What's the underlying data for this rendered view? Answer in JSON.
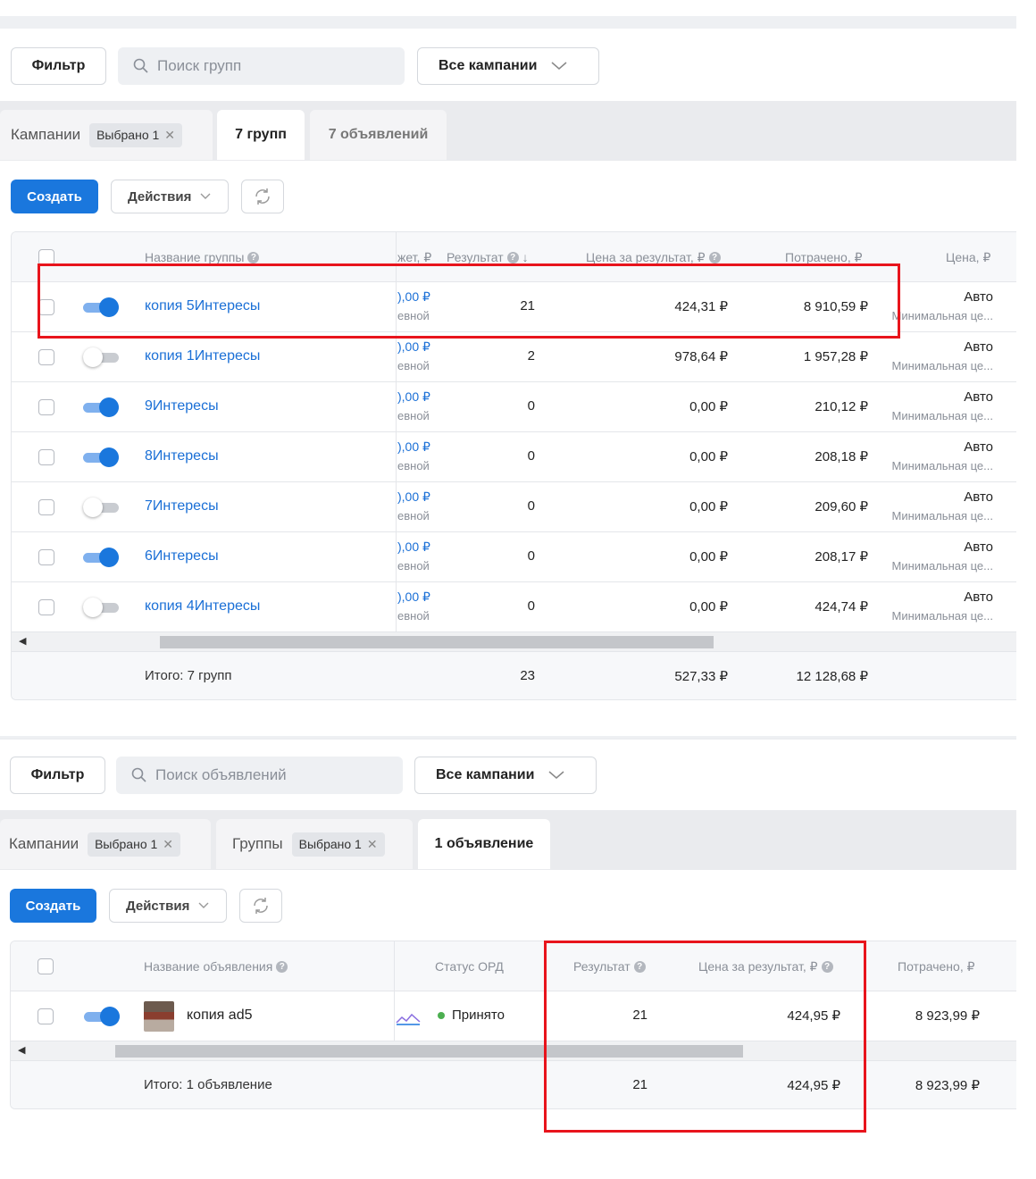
{
  "panel1": {
    "toolbar": {
      "filter_label": "Фильтр",
      "search_placeholder": "Поиск групп",
      "campaigns_select": "Все кампании"
    },
    "tabs": {
      "campaigns_label": "Кампании",
      "campaigns_chip": "Выбрано 1",
      "groups_tab": "7 групп",
      "ads_tab": "7 объявлений"
    },
    "actions": {
      "create": "Создать",
      "actions": "Действия"
    },
    "table": {
      "headers": {
        "name": "Название группы",
        "budget": "жет, ₽",
        "result": "Результат",
        "cost_per_result": "Цена за результат, ₽",
        "spent": "Потрачено, ₽",
        "price": "Цена, ₽"
      },
      "rows": [
        {
          "name": "копия 5Интересы",
          "toggle": "on",
          "budget": "),00 ₽",
          "budget_sub": "евной",
          "result": "21",
          "cpr": "424,31 ₽",
          "spent": "8 910,59 ₽",
          "price": "Авто",
          "price_sub": "Минимальная це..."
        },
        {
          "name": "копия 1Интересы",
          "toggle": "off",
          "budget": "),00 ₽",
          "budget_sub": "евной",
          "result": "2",
          "cpr": "978,64 ₽",
          "spent": "1 957,28 ₽",
          "price": "Авто",
          "price_sub": "Минимальная це..."
        },
        {
          "name": "9Интересы",
          "toggle": "on",
          "budget": "),00 ₽",
          "budget_sub": "евной",
          "result": "0",
          "cpr": "0,00 ₽",
          "spent": "210,12 ₽",
          "price": "Авто",
          "price_sub": "Минимальная це..."
        },
        {
          "name": "8Интересы",
          "toggle": "on",
          "budget": "),00 ₽",
          "budget_sub": "евной",
          "result": "0",
          "cpr": "0,00 ₽",
          "spent": "208,18 ₽",
          "price": "Авто",
          "price_sub": "Минимальная це..."
        },
        {
          "name": "7Интересы",
          "toggle": "off",
          "budget": "),00 ₽",
          "budget_sub": "евной",
          "result": "0",
          "cpr": "0,00 ₽",
          "spent": "209,60 ₽",
          "price": "Авто",
          "price_sub": "Минимальная це..."
        },
        {
          "name": "6Интересы",
          "toggle": "on",
          "budget": "),00 ₽",
          "budget_sub": "евной",
          "result": "0",
          "cpr": "0,00 ₽",
          "spent": "208,17 ₽",
          "price": "Авто",
          "price_sub": "Минимальная це..."
        },
        {
          "name": "копия 4Интересы",
          "toggle": "off",
          "budget": "),00 ₽",
          "budget_sub": "евной",
          "result": "0",
          "cpr": "0,00 ₽",
          "spent": "424,74 ₽",
          "price": "Авто",
          "price_sub": "Минимальная це..."
        }
      ],
      "totals": {
        "label": "Итого: 7 групп",
        "result": "23",
        "cpr": "527,33 ₽",
        "spent": "12 128,68 ₽"
      }
    }
  },
  "panel2": {
    "toolbar": {
      "filter_label": "Фильтр",
      "search_placeholder": "Поиск объявлений",
      "campaigns_select": "Все кампании"
    },
    "tabs": {
      "campaigns_label": "Кампании",
      "campaigns_chip": "Выбрано 1",
      "groups_label": "Группы",
      "groups_chip": "Выбрано 1",
      "ads_tab": "1 объявление"
    },
    "actions": {
      "create": "Создать",
      "actions": "Действия"
    },
    "table": {
      "headers": {
        "name": "Название объявления",
        "ord_status": "Статус ОРД",
        "result": "Результат",
        "cost_per_result": "Цена за результат, ₽",
        "spent": "Потрачено, ₽"
      },
      "rows": [
        {
          "name": "копия ad5",
          "toggle": "on",
          "ord_status": "Принято",
          "result": "21",
          "cpr": "424,95 ₽",
          "spent": "8 923,99 ₽"
        }
      ],
      "totals": {
        "label": "Итого: 1 объявление",
        "result": "21",
        "cpr": "424,95 ₽",
        "spent": "8 923,99 ₽"
      }
    }
  },
  "colors": {
    "accent": "#1a77dd",
    "link": "#1a6fd6",
    "highlight": "#e8141c",
    "status_ok": "#4caf50"
  }
}
